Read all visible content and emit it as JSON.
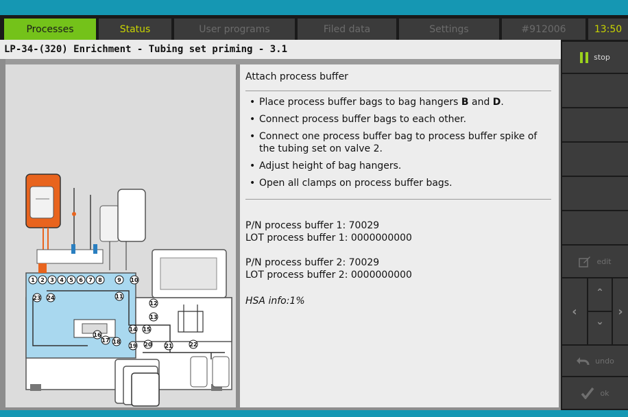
{
  "tabs": [
    {
      "label": "Processes"
    },
    {
      "label": "Status"
    },
    {
      "label": "User programs"
    },
    {
      "label": "Filed data"
    },
    {
      "label": "Settings"
    },
    {
      "label": "#912006"
    },
    {
      "label": "13:50"
    }
  ],
  "page_title": "LP-34-(320) Enrichment - Tubing set priming - 3.1",
  "instructions": {
    "heading": "Attach process buffer",
    "steps": [
      {
        "pre": "Place process buffer bags to bag hangers ",
        "b1": "B",
        "mid": " and ",
        "b2": "D",
        "post": "."
      },
      {
        "text": "Connect process buffer bags to each other."
      },
      {
        "text": "Connect one process buffer bag to process buffer spike of the tubing set on valve 2."
      },
      {
        "text": "Adjust height of bag hangers."
      },
      {
        "text": "Open all clamps on process buffer bags."
      }
    ]
  },
  "info": {
    "pn1": "P/N process buffer 1: 70029",
    "lot1": "LOT process buffer 1: 0000000000",
    "pn2": "P/N process buffer 2: 70029",
    "lot2": "LOT process buffer 2: 0000000000",
    "hsa": "HSA info:1%"
  },
  "diagram": {
    "valve_numbers": [
      "1",
      "2",
      "3",
      "4",
      "5",
      "6",
      "7",
      "8",
      "9",
      "10",
      "11",
      "12",
      "13",
      "14",
      "15",
      "16",
      "17",
      "18",
      "19",
      "20",
      "21",
      "22",
      "23",
      "24"
    ]
  },
  "sidebar": {
    "stop_label": "stop",
    "edit_label": "edit",
    "undo_label": "undo",
    "ok_label": "ok"
  },
  "colors": {
    "accent_teal": "#1597b3",
    "active_tab": "#74c21a",
    "status_text": "#c8d400",
    "bag_orange": "#e8641e",
    "machine_blue": "#a9d8ef"
  }
}
